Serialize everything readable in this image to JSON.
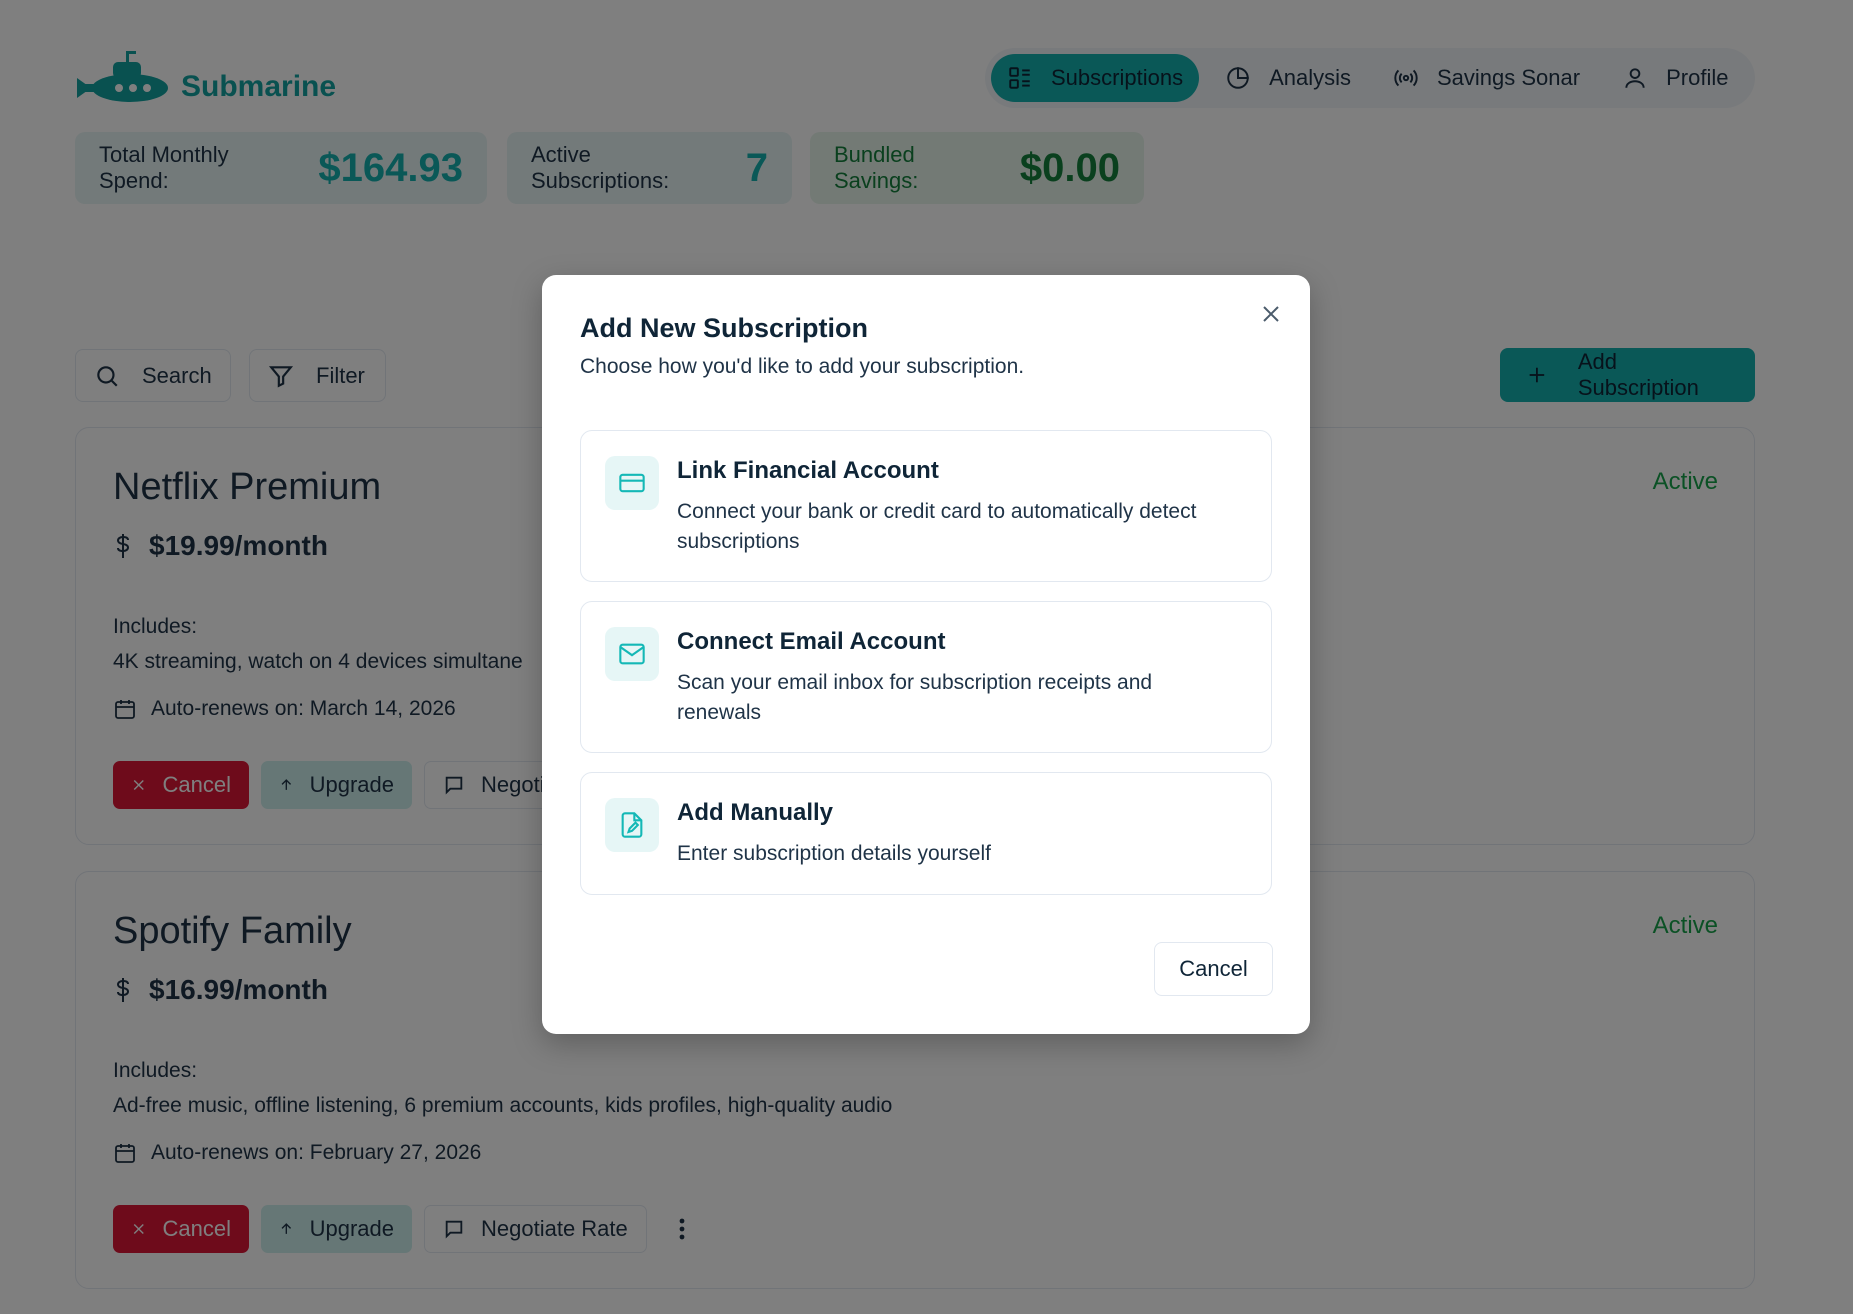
{
  "app": {
    "name": "Submarine"
  },
  "nav": {
    "items": [
      {
        "label": "Subscriptions",
        "icon": "subscriptions-list-icon",
        "active": true
      },
      {
        "label": "Analysis",
        "icon": "pie-chart-icon",
        "active": false
      },
      {
        "label": "Savings Sonar",
        "icon": "broadcast-icon",
        "active": false
      },
      {
        "label": "Profile",
        "icon": "user-icon",
        "active": false
      }
    ]
  },
  "stats": {
    "total_spend": {
      "label": "Total Monthly Spend:",
      "value": "$164.93"
    },
    "active": {
      "label": "Active Subscriptions:",
      "value": "7"
    },
    "bundled": {
      "label": "Bundled Savings:",
      "value": "$0.00"
    }
  },
  "toolbar": {
    "search_label": "Search",
    "filter_label": "Filter",
    "add_label": "Add Subscription"
  },
  "subscriptions": [
    {
      "name": "Netflix Premium",
      "status": "Active",
      "price": "$19.99/month",
      "includes_label": "Includes:",
      "includes": "4K streaming, watch on 4 devices simultane",
      "renews": "Auto-renews on: March 14, 2026",
      "actions": {
        "cancel": "Cancel",
        "upgrade": "Upgrade",
        "negotiate": "Negoti"
      }
    },
    {
      "name": "Spotify Family",
      "status": "Active",
      "price": "$16.99/month",
      "includes_label": "Includes:",
      "includes": "Ad-free music, offline listening, 6 premium accounts, kids profiles, high-quality audio",
      "renews": "Auto-renews on: February 27, 2026",
      "actions": {
        "cancel": "Cancel",
        "upgrade": "Upgrade",
        "negotiate": "Negotiate Rate"
      }
    }
  ],
  "modal": {
    "title": "Add New Subscription",
    "subtitle": "Choose how you'd like to add your subscription.",
    "options": [
      {
        "title": "Link Financial Account",
        "description": "Connect your bank or credit card to automatically detect subscriptions",
        "icon": "credit-card-icon"
      },
      {
        "title": "Connect Email Account",
        "description": "Scan your email inbox for subscription receipts and renewals",
        "icon": "mail-icon"
      },
      {
        "title": "Add Manually",
        "description": "Enter subscription details yourself",
        "icon": "file-edit-icon"
      }
    ],
    "cancel_label": "Cancel"
  },
  "colors": {
    "accent": "#14b0ae",
    "danger": "#dc1637",
    "success": "#16a34a",
    "text": "#1f3347",
    "overlay": "rgba(0,0,0,0.5)"
  }
}
